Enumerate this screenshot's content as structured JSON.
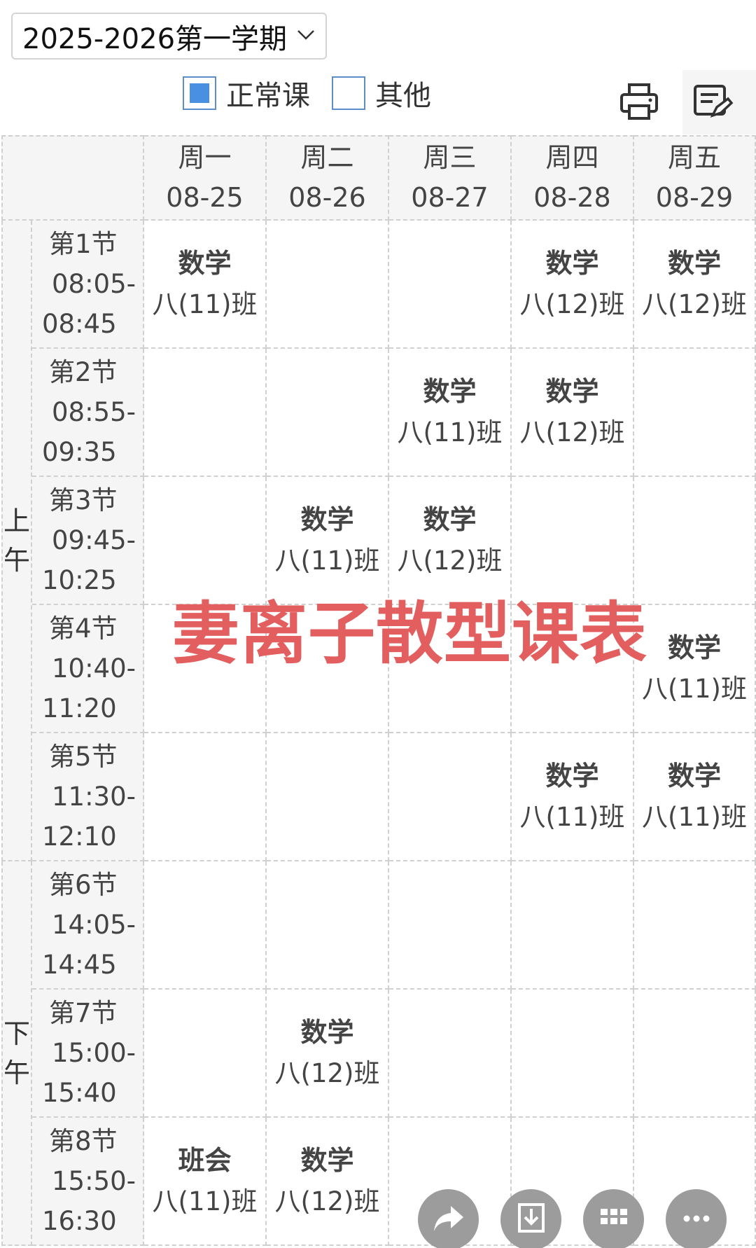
{
  "semester": {
    "selected": "2025-2026第一学期"
  },
  "filters": [
    {
      "label": "正常课",
      "checked": true
    },
    {
      "label": "其他",
      "checked": false
    }
  ],
  "toolbar": {
    "print_icon": "printer-icon",
    "edit_icon": "edit-share-icon"
  },
  "days": [
    {
      "name": "周一",
      "date": "08-25"
    },
    {
      "name": "周二",
      "date": "08-26"
    },
    {
      "name": "周三",
      "date": "08-27"
    },
    {
      "name": "周四",
      "date": "08-28"
    },
    {
      "name": "周五",
      "date": "08-29"
    }
  ],
  "parts": [
    {
      "label_top": "上",
      "label_bottom": "午"
    },
    {
      "label_top": "下",
      "label_bottom": "午"
    }
  ],
  "periods": [
    {
      "name": "第1节",
      "start": "08:05-",
      "end": "08:45"
    },
    {
      "name": "第2节",
      "start": "08:55-",
      "end": "09:35"
    },
    {
      "name": "第3节",
      "start": "09:45-",
      "end": "10:25"
    },
    {
      "name": "第4节",
      "start": "10:40-",
      "end": "11:20"
    },
    {
      "name": "第5节",
      "start": "11:30-",
      "end": "12:10"
    },
    {
      "name": "第6节",
      "start": "14:05-",
      "end": "14:45"
    },
    {
      "name": "第7节",
      "start": "15:00-",
      "end": "15:40"
    },
    {
      "name": "第8节",
      "start": "15:50-",
      "end": "16:30"
    }
  ],
  "schedule": [
    [
      {
        "subject": "数学",
        "class": "八(11)班"
      },
      {},
      {},
      {
        "subject": "数学",
        "class": "八(12)班"
      },
      {
        "subject": "数学",
        "class": "八(12)班"
      }
    ],
    [
      {},
      {},
      {
        "subject": "数学",
        "class": "八(11)班"
      },
      {
        "subject": "数学",
        "class": "八(12)班"
      },
      {}
    ],
    [
      {},
      {
        "subject": "数学",
        "class": "八(11)班"
      },
      {
        "subject": "数学",
        "class": "八(12)班"
      },
      {},
      {}
    ],
    [
      {},
      {},
      {},
      {},
      {
        "subject": "数学",
        "class": "八(11)班"
      }
    ],
    [
      {},
      {},
      {},
      {
        "subject": "数学",
        "class": "八(11)班"
      },
      {
        "subject": "数学",
        "class": "八(11)班"
      }
    ],
    [
      {},
      {},
      {},
      {},
      {}
    ],
    [
      {},
      {
        "subject": "数学",
        "class": "八(12)班"
      },
      {},
      {},
      {}
    ],
    [
      {
        "subject": "班会",
        "class": "八(11)班"
      },
      {
        "subject": "数学",
        "class": "八(12)班"
      },
      {},
      {},
      {}
    ]
  ],
  "watermark": "妻离子散型课表",
  "fabs": [
    {
      "icon": "share-arrow-icon"
    },
    {
      "icon": "download-icon"
    },
    {
      "icon": "grid-icon"
    },
    {
      "icon": "more-icon"
    }
  ],
  "colors": {
    "accent": "#4a90e2",
    "watermark": "#e35f5f",
    "header_bg": "#f5f5f5",
    "fab": "#9c9c9c"
  }
}
